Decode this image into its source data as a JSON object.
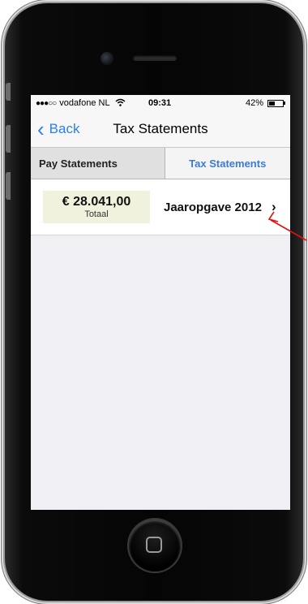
{
  "status_bar": {
    "signal": "●●●○○",
    "carrier": "vodafone NL",
    "time": "09:31",
    "battery_percent": "42%",
    "battery_level": 0.42
  },
  "nav": {
    "back_label": "Back",
    "title": "Tax Statements"
  },
  "tabs": [
    {
      "label": "Pay Statements",
      "selected": false
    },
    {
      "label": "Tax Statements",
      "selected": true
    }
  ],
  "statements": [
    {
      "amount": "€ 28.041,00",
      "amount_caption": "Totaal",
      "title": "Jaaropgave 2012"
    }
  ],
  "colors": {
    "accent": "#2a7ff0",
    "annotation_arrow": "#e01010",
    "amount_box_bg": "#f1f2dd"
  }
}
